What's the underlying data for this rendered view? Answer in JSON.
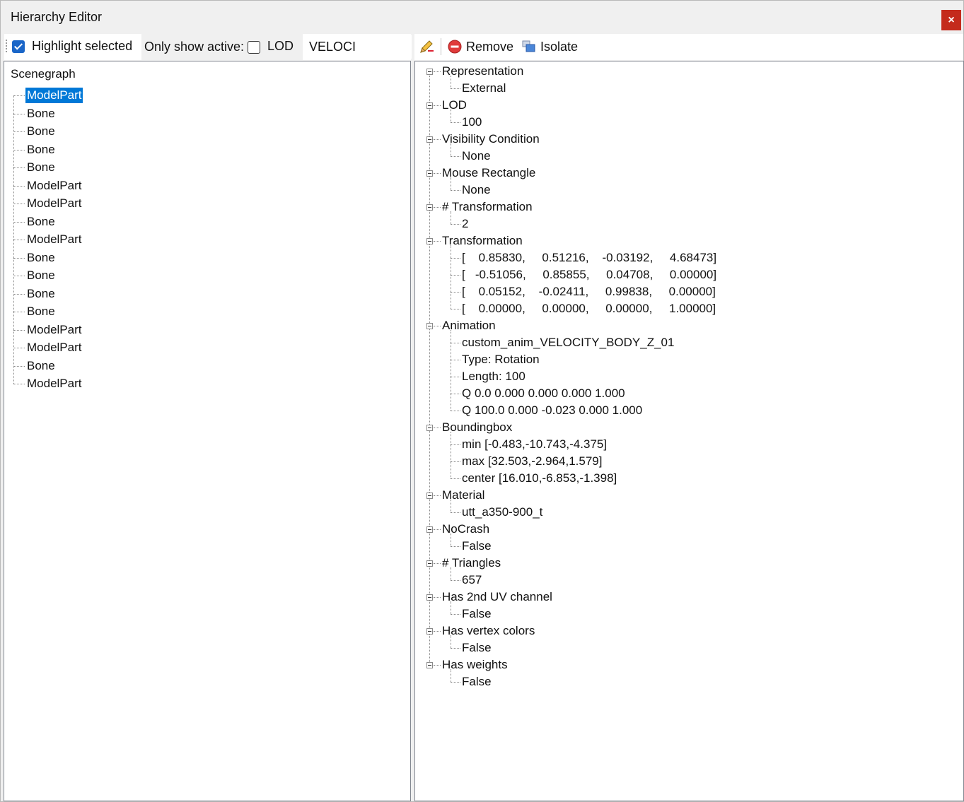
{
  "window": {
    "title": "Hierarchy Editor",
    "close_label": "×"
  },
  "toolbar": {
    "highlight_selected_label": "Highlight selected",
    "highlight_selected_checked": true,
    "only_show_active_label": "Only show active:",
    "lod_label": "LOD",
    "lod_checked": false,
    "search_value": "VELOCI",
    "remove_label": "Remove",
    "isolate_label": "Isolate"
  },
  "scenegraph": {
    "title": "Scenegraph",
    "items": [
      "ModelPart",
      "Bone",
      "Bone",
      "Bone",
      "Bone",
      "ModelPart",
      "ModelPart",
      "Bone",
      "ModelPart",
      "Bone",
      "Bone",
      "Bone",
      "Bone",
      "ModelPart",
      "ModelPart",
      "Bone",
      "ModelPart"
    ],
    "selected_index": 0
  },
  "properties": [
    {
      "label": "Representation",
      "children": [
        "External"
      ]
    },
    {
      "label": "LOD",
      "children": [
        "100"
      ]
    },
    {
      "label": "Visibility Condition",
      "children": [
        "None"
      ]
    },
    {
      "label": "Mouse Rectangle",
      "children": [
        "None"
      ]
    },
    {
      "label": "# Transformation",
      "children": [
        "2"
      ]
    },
    {
      "label": "Transformation",
      "children": [
        "[    0.85830,     0.51216,    -0.03192,     4.68473]",
        "[   -0.51056,     0.85855,     0.04708,     0.00000]",
        "[    0.05152,    -0.02411,     0.99838,     0.00000]",
        "[    0.00000,     0.00000,     0.00000,     1.00000]"
      ]
    },
    {
      "label": "Animation",
      "children": [
        "custom_anim_VELOCITY_BODY_Z_01",
        "Type: Rotation",
        "Length: 100",
        "Q 0.0 0.000 0.000 0.000 1.000",
        "Q 100.0 0.000 -0.023 0.000 1.000"
      ]
    },
    {
      "label": "Boundingbox",
      "children": [
        "min [-0.483,-10.743,-4.375]",
        "max [32.503,-2.964,1.579]",
        "center [16.010,-6.853,-1.398]"
      ]
    },
    {
      "label": "Material",
      "children": [
        "utt_a350-900_t"
      ]
    },
    {
      "label": "NoCrash",
      "children": [
        "False"
      ]
    },
    {
      "label": "# Triangles",
      "children": [
        "657"
      ]
    },
    {
      "label": "Has 2nd UV channel",
      "children": [
        "False"
      ]
    },
    {
      "label": "Has vertex colors",
      "children": [
        "False"
      ]
    },
    {
      "label": "Has weights",
      "children": [
        "False"
      ]
    }
  ]
}
